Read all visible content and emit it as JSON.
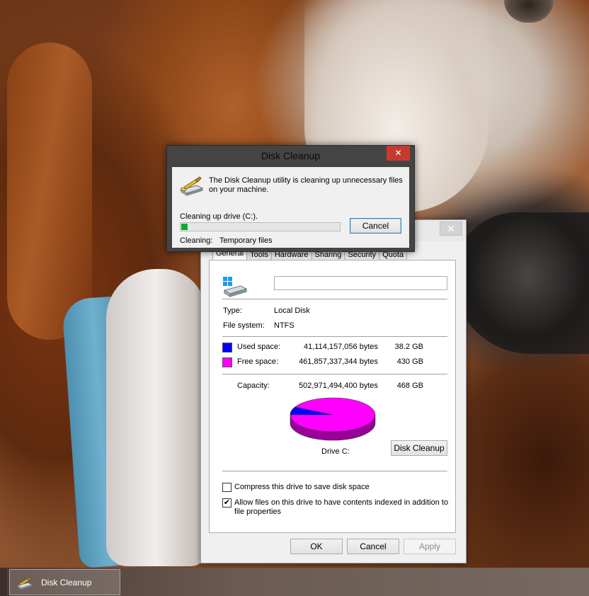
{
  "disk_cleanup_dialog": {
    "title": "Disk Cleanup",
    "close_glyph": "✕",
    "message": "The Disk Cleanup utility is cleaning up unnecessary files on your machine.",
    "drive_status": "Cleaning up drive  (C:).",
    "progress_fraction": 0.04,
    "progress_color": "#06b025",
    "cancel_label": "Cancel",
    "cleaning_label": "Cleaning:",
    "cleaning_item": "Temporary files",
    "icon": "disk-cleanup-icon"
  },
  "properties_window": {
    "close_glyph": "✕",
    "tabs": [
      "General",
      "Tools",
      "Hardware",
      "Sharing",
      "Security",
      "Quota"
    ],
    "active_tab": "General",
    "drive_name_value": "",
    "type_label": "Type:",
    "type_value": "Local Disk",
    "filesystem_label": "File system:",
    "filesystem_value": "NTFS",
    "used": {
      "label": "Used space:",
      "bytes": "41,114,157,056 bytes",
      "gb": "38.2 GB",
      "color": "#0000ff"
    },
    "free": {
      "label": "Free space:",
      "bytes": "461,857,337,344 bytes",
      "gb": "430 GB",
      "color": "#ff00ff"
    },
    "capacity": {
      "label": "Capacity:",
      "bytes": "502,971,494,400 bytes",
      "gb": "468 GB"
    },
    "used_fraction": 0.076,
    "drive_label": "Drive C:",
    "disk_cleanup_button": "Disk Cleanup",
    "compress_label": "Compress this drive to save disk space",
    "compress_checked": false,
    "index_label_line1": "Allow files on this drive to have contents indexed in addition to",
    "index_label_line2": "file properties",
    "index_checked": true,
    "ok_label": "OK",
    "cancel_label": "Cancel",
    "apply_label": "Apply",
    "check_glyph": "✔"
  },
  "taskbar": {
    "button_label": "Disk Cleanup",
    "icon": "disk-cleanup-icon"
  }
}
